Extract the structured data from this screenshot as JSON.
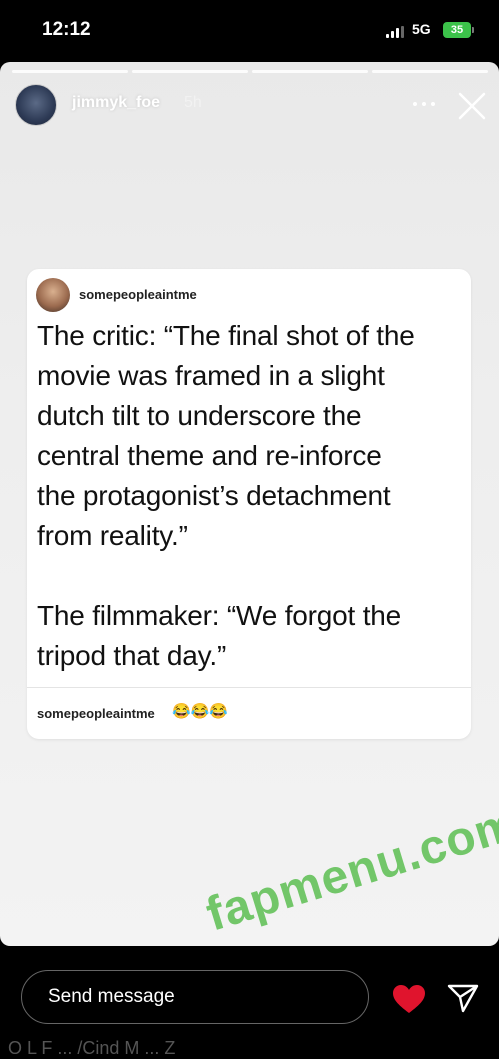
{
  "status_bar": {
    "time": "12:12",
    "network": "5G",
    "battery": "35"
  },
  "story": {
    "username": "jimmyk_foe",
    "timeago": "5h",
    "progress_segments": 4
  },
  "post": {
    "author": "somepeopleaintme",
    "text": "The critic: “The final shot of the\nmovie was framed in a slight\ndutch tilt to underscore the\ncentral theme and re-inforce\nthe protagonist’s detachment\nfrom reality.”\n\nThe filmmaker: “We forgot the\ntripod that day.”",
    "footer_author": "somepeopleaintme",
    "footer_emoji": "😂😂😂"
  },
  "watermark": "fapmenu.com",
  "bottom": {
    "send_placeholder": "Send message",
    "faint_text": "O L F ... /Cind M ... Z"
  },
  "colors": {
    "battery": "#3cc24a",
    "heart": "#e0142d",
    "watermark": "#5cbf52"
  },
  "icons": [
    "signal-icon",
    "more-icon",
    "close-icon",
    "heart-icon",
    "share-icon"
  ]
}
